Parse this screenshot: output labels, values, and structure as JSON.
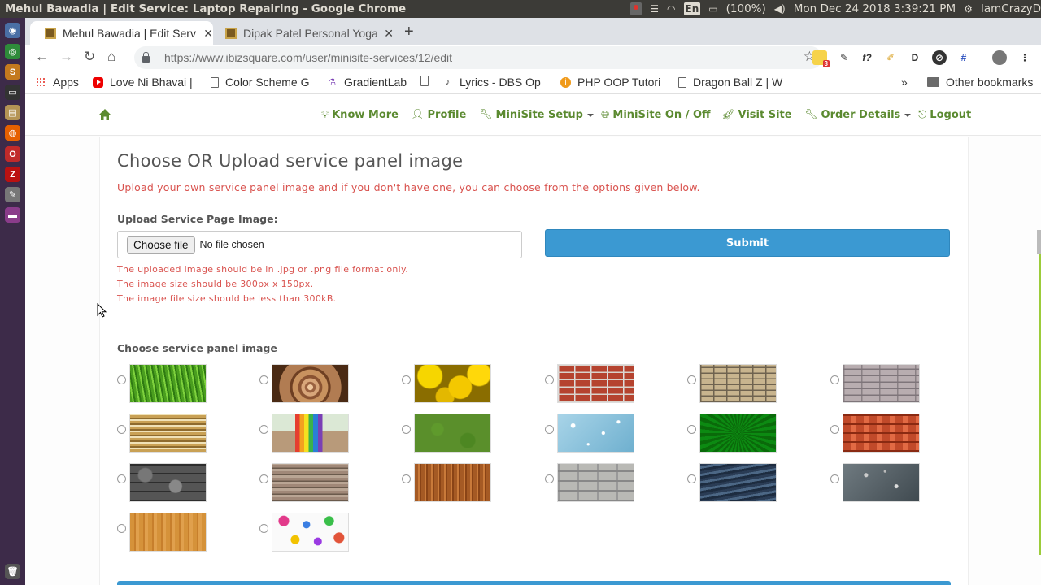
{
  "os": {
    "window_title": "Mehul Bawadia | Edit Service: Laptop Repairing - Google Chrome",
    "keyboard_layout": "En",
    "battery": "(100%)",
    "datetime": "Mon Dec 24 2018  3:39:21 PM",
    "username": "IamCrazyD"
  },
  "browser": {
    "tabs": [
      {
        "label": "Mehul Bawadia | Edit Serv",
        "active": true
      },
      {
        "label": "Dipak Patel Personal Yoga",
        "active": false
      }
    ],
    "new_tab_label": "+",
    "url_host": "https://www.ibizsquare.com",
    "url_path": "/user/minisite-services/12/edit",
    "extensions": [
      "f?",
      "D"
    ],
    "extension_badge": "3",
    "bookmarks": [
      {
        "label": "Apps",
        "icon": "apps-grid-icon"
      },
      {
        "label": "Love Ni Bhavai |",
        "icon": "youtube-icon"
      },
      {
        "label": "Color Scheme G",
        "icon": "page-icon"
      },
      {
        "label": "GradientLab",
        "icon": "flask-icon"
      },
      {
        "label": "",
        "icon": "page-icon"
      },
      {
        "label": "Lyrics - DBS Op",
        "icon": "lyrics-icon"
      },
      {
        "label": "PHP OOP Tutori",
        "icon": "info-icon"
      },
      {
        "label": "Dragon Ball Z | W",
        "icon": "page-icon"
      }
    ],
    "bookmarks_overflow": "»",
    "other_bookmarks": "Other bookmarks"
  },
  "site_nav": {
    "items": [
      {
        "label": "Know More",
        "icon": "lightbulb-icon",
        "dropdown": false
      },
      {
        "label": "Profile",
        "icon": "user-icon",
        "dropdown": false
      },
      {
        "label": "MiniSite Setup",
        "icon": "wrench-icon",
        "dropdown": true
      },
      {
        "label": "MiniSite On / Off",
        "icon": "globe-icon",
        "dropdown": false
      },
      {
        "label": "Visit Site",
        "icon": "rocket-icon",
        "dropdown": false
      },
      {
        "label": "Order Details",
        "icon": "wrench-icon",
        "dropdown": true
      },
      {
        "label": "Logout",
        "icon": "logout-icon",
        "dropdown": false
      }
    ],
    "accent_color": "#5b8a30"
  },
  "panel": {
    "title": "Choose OR Upload service panel image",
    "subtitle": "Upload your own service panel image and if you don't have one, you can choose from the options given below.",
    "upload_label": "Upload Service Page Image:",
    "choose_file_button": "Choose file",
    "no_file_text": "No file chosen",
    "submit_label": "Submit",
    "notes": [
      "The uploaded image should be in .jpg or .png file format only.",
      "The image size should be 300px x 150px.",
      "The image file size should be less than 300kB."
    ],
    "choose_label": "Choose service panel image",
    "images": [
      {
        "name": "grass"
      },
      {
        "name": "tree-rings"
      },
      {
        "name": "yellow-fruit"
      },
      {
        "name": "red-brick"
      },
      {
        "name": "sandstone-brick"
      },
      {
        "name": "grey-brick"
      },
      {
        "name": "coin-stacks"
      },
      {
        "name": "rainbow-cup"
      },
      {
        "name": "moss"
      },
      {
        "name": "water-drops"
      },
      {
        "name": "green-burst"
      },
      {
        "name": "roof-tiles"
      },
      {
        "name": "dark-stone-wall"
      },
      {
        "name": "flat-stone-wall"
      },
      {
        "name": "bamboo"
      },
      {
        "name": "grey-stone-wall"
      },
      {
        "name": "sea-water"
      },
      {
        "name": "rain-glass"
      },
      {
        "name": "plywood"
      },
      {
        "name": "butterflies"
      }
    ],
    "accent_color": "#3b99d2",
    "warning_color": "#d9534f"
  }
}
